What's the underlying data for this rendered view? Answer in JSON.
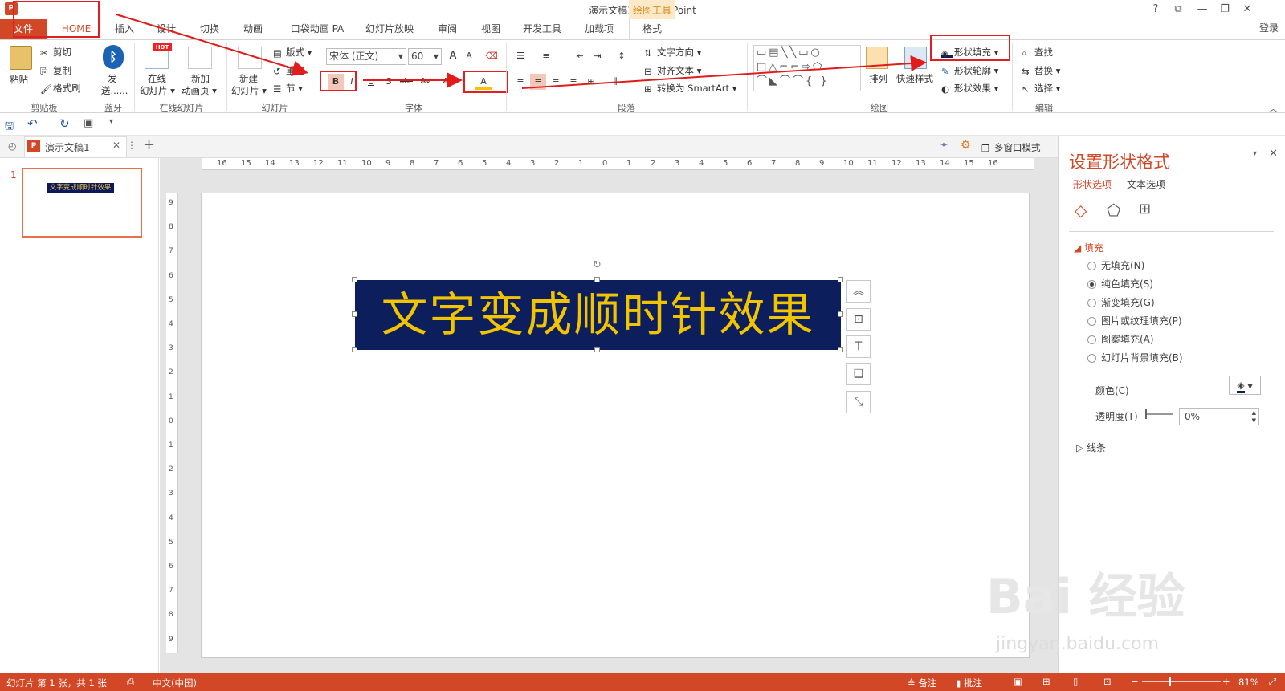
{
  "window": {
    "title": "演示文稿1 - PowerPoint",
    "help": "?",
    "signin": "登录"
  },
  "tabs": {
    "file": "文件",
    "home": "HOME",
    "insert": "插入",
    "design": "设计",
    "transitions": "切换",
    "animations": "动画",
    "pocket": "口袋动画 PA",
    "slideshow": "幻灯片放映",
    "review": "审阅",
    "view": "视图",
    "developer": "开发工具",
    "addins": "加载项",
    "context_group": "绘图工具",
    "format": "格式"
  },
  "ribbon": {
    "clipboard": {
      "paste": "粘贴",
      "cut": "剪切",
      "copy": "复制",
      "format_painter": "格式刷",
      "label": "剪贴板"
    },
    "bluetooth": {
      "send1": "发",
      "send2": "送......",
      "label": "蓝牙"
    },
    "online": {
      "online1": "在线",
      "online2": "幻灯片 ▾",
      "new_anim1": "新加",
      "new_anim2": "动画页 ▾",
      "hot": "HOT",
      "label": "在线幻灯片"
    },
    "slides": {
      "new1": "新建",
      "new2": "幻灯片 ▾",
      "layout": "版式 ▾",
      "reset": "重置",
      "section": "节 ▾",
      "label": "幻灯片"
    },
    "font": {
      "name": "宋体 (正文)",
      "size": "60",
      "bold": "B",
      "italic": "I",
      "underline": "U",
      "shadow": "S",
      "strike": "abc",
      "spacing": "AV",
      "case": "Aa",
      "color": "A",
      "grow": "A",
      "shrink": "A",
      "label": "字体"
    },
    "paragraph": {
      "text_direction": "文字方向 ▾",
      "align_text": "对齐文本 ▾",
      "smartart": "转换为 SmartArt ▾",
      "label": "段落"
    },
    "drawing": {
      "arrange": "排列",
      "quick_styles": "快速样式",
      "shape_fill": "形状填充 ▾",
      "shape_outline": "形状轮廓 ▾",
      "shape_effects": "形状效果 ▾",
      "label": "绘图"
    },
    "editing": {
      "find": "查找",
      "replace": "替换 ▾",
      "select": "选择 ▾",
      "label": "编辑"
    }
  },
  "doc_tab": {
    "name": "演示文稿1"
  },
  "toolbar_right": {
    "multiwindow": "多窗口模式"
  },
  "thumbnail": {
    "number": "1",
    "text": "文字变成顺时针效果"
  },
  "slide": {
    "text": "文字变成顺时针效果",
    "box_color": "#0c1e5b",
    "text_color": "#f2c400"
  },
  "ruler": {
    "h_ticks": [
      "16",
      "15",
      "14",
      "13",
      "12",
      "11",
      "10",
      "9",
      "8",
      "7",
      "6",
      "5",
      "4",
      "3",
      "2",
      "1",
      "0",
      "1",
      "2",
      "3",
      "4",
      "5",
      "6",
      "7",
      "8",
      "9",
      "10",
      "11",
      "12",
      "13",
      "14",
      "15",
      "16"
    ],
    "v_ticks": [
      "9",
      "8",
      "7",
      "6",
      "5",
      "4",
      "3",
      "2",
      "1",
      "0",
      "1",
      "2",
      "3",
      "4",
      "5",
      "6",
      "7",
      "8",
      "9"
    ]
  },
  "panel": {
    "title": "设置形状格式",
    "tab_shape": "形状选项",
    "tab_text": "文本选项",
    "fill_section": "填充",
    "options": [
      "无填充(N)",
      "纯色填充(S)",
      "渐变填充(G)",
      "图片或纹理填充(P)",
      "图案填充(A)",
      "幻灯片背景填充(B)"
    ],
    "selected_index": 1,
    "color_label": "颜色(C)",
    "transparency_label": "透明度(T)",
    "transparency_value": "0%",
    "line_section": "线条"
  },
  "status": {
    "slide_info": "幻灯片 第 1 张，共 1 张",
    "language": "中文(中国)",
    "notes": "备注",
    "comments": "批注",
    "zoom": "81%"
  },
  "watermark": {
    "brand": "Bai 经验",
    "url": "jingyan.baidu.com"
  }
}
